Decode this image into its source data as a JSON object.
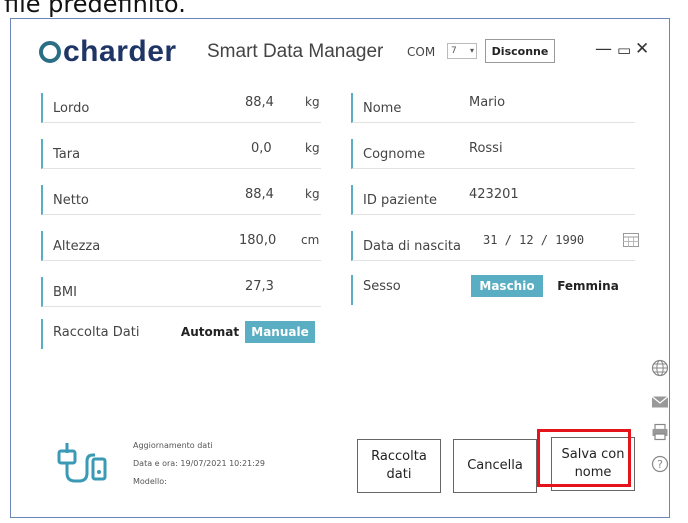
{
  "background_caption": "file predefinito.",
  "app": {
    "logo_text": "charder",
    "title": "Smart Data Manager",
    "com_label": "COM",
    "com_value": "7",
    "disconnect_label": "Disconne",
    "minimize_glyph": "—",
    "restore_glyph": "▭",
    "close_glyph": "✕"
  },
  "left_fields": [
    {
      "label": "Lordo",
      "value": "88,4",
      "unit": "kg"
    },
    {
      "label": "Tara",
      "value": "0,0",
      "unit": "kg"
    },
    {
      "label": "Netto",
      "value": "88,4",
      "unit": "kg"
    },
    {
      "label": "Altezza",
      "value": "180,0",
      "unit": "cm"
    },
    {
      "label": "BMI",
      "value": "27,3",
      "unit": ""
    }
  ],
  "raccolta": {
    "label": "Raccolta Dati",
    "automat": "Automat",
    "manuale": "Manuale",
    "selected": "Manuale"
  },
  "right_fields": {
    "nome": {
      "label": "Nome",
      "value": "Mario"
    },
    "cognome": {
      "label": "Cognome",
      "value": "Rossi"
    },
    "id": {
      "label": "ID paziente",
      "value": "423201"
    },
    "dob": {
      "label": "Data di nascita",
      "value": "31 / 12 / 1990"
    }
  },
  "sesso": {
    "label": "Sesso",
    "maschio": "Maschio",
    "femmina": "Femmina",
    "selected": "Maschio"
  },
  "status": {
    "line1": "Aggiornamento dati",
    "line2": "Data e ora: 19/07/2021 10:21:29",
    "line3": "Modello:"
  },
  "buttons": {
    "raccolta": "Raccolta\ndati",
    "cancella": "Cancella",
    "salva": "Salva con\nnome"
  },
  "side_icons": [
    "globe-icon",
    "mail-icon",
    "printer-icon",
    "help-icon"
  ],
  "colors": {
    "accent": "#5aaec3",
    "logo": "#1f3566",
    "highlight": "#e5141b"
  }
}
